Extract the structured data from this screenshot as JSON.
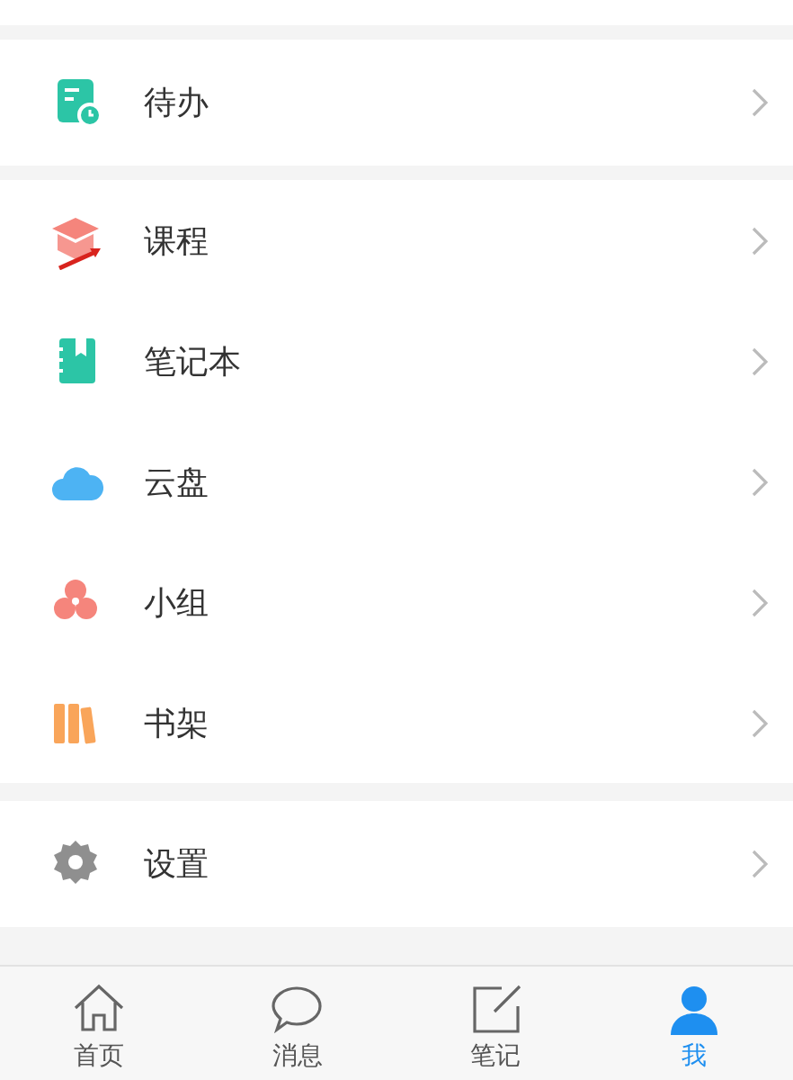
{
  "menu_sections": [
    {
      "items": [
        {
          "label": "待办",
          "kind": "todo"
        }
      ]
    },
    {
      "items": [
        {
          "label": "课程",
          "kind": "course"
        },
        {
          "label": "笔记本",
          "kind": "notebook"
        },
        {
          "label": "云盘",
          "kind": "cloud"
        },
        {
          "label": "小组",
          "kind": "group"
        },
        {
          "label": "书架",
          "kind": "bookshelf"
        }
      ]
    },
    {
      "items": [
        {
          "label": "设置",
          "kind": "settings"
        }
      ]
    }
  ],
  "tab_bar": [
    {
      "label": "首页",
      "kind": "home",
      "selected": false
    },
    {
      "label": "消息",
      "kind": "message",
      "selected": false
    },
    {
      "label": "笔记",
      "kind": "note",
      "selected": false
    },
    {
      "label": "我",
      "kind": "me",
      "selected": true
    }
  ]
}
